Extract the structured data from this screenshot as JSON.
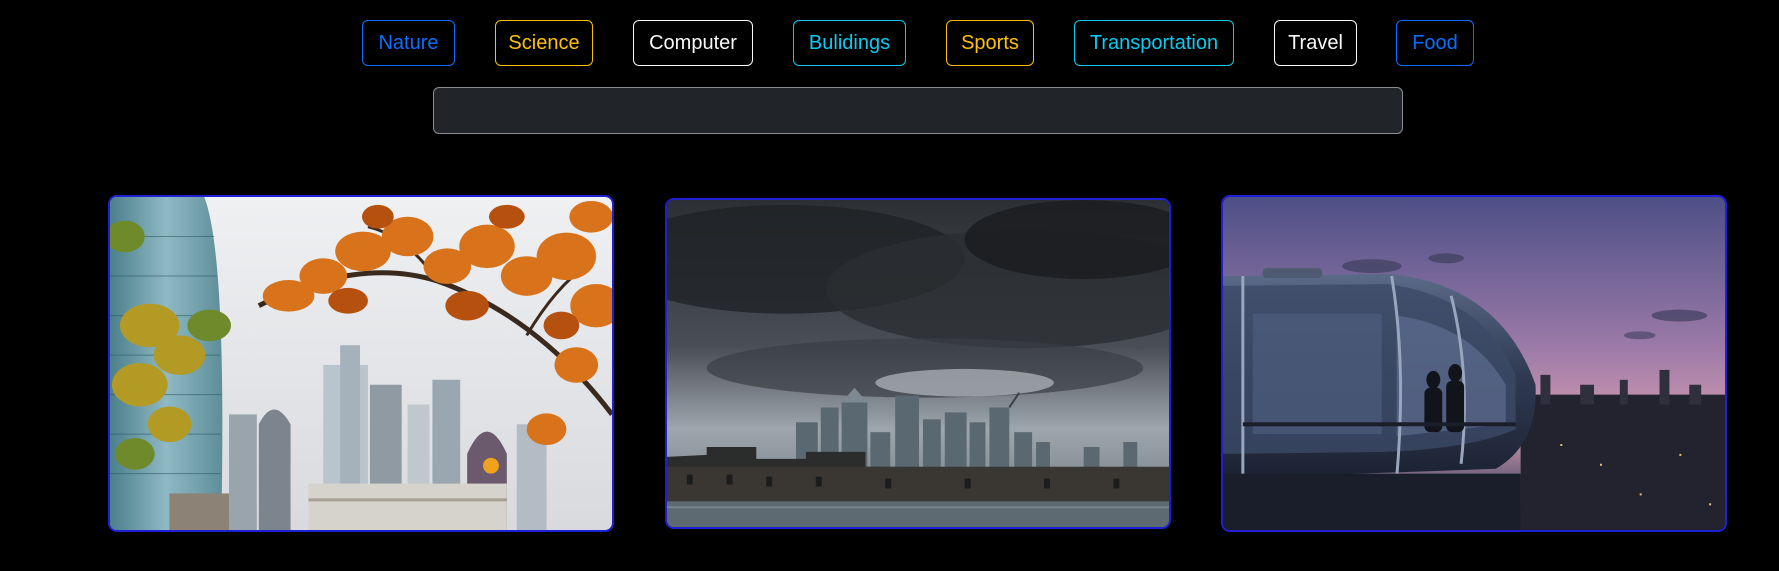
{
  "categories": [
    {
      "label": "Nature",
      "color": "#0d6efd"
    },
    {
      "label": "Science",
      "color": "#ffc107"
    },
    {
      "label": "Computer",
      "color": "#f8f9fa"
    },
    {
      "label": "Bulidings",
      "color": "#0dcaf0"
    },
    {
      "label": "Sports",
      "color": "#ffc107"
    },
    {
      "label": "Transportation",
      "color": "#0dcaf0"
    },
    {
      "label": "Travel",
      "color": "#f8f9fa"
    },
    {
      "label": "Food",
      "color": "#0d6efd"
    }
  ],
  "search": {
    "value": "",
    "placeholder": ""
  },
  "gallery": {
    "images": [
      {
        "subject": "autumn-oak-leaves-city-skyline"
      },
      {
        "subject": "stormy-sky-city-skyline-river"
      },
      {
        "subject": "observation-capsule-sunset-city"
      }
    ]
  },
  "colors": {
    "background": "#000000",
    "card_border": "#1f1fd6",
    "input_background": "#212529"
  }
}
